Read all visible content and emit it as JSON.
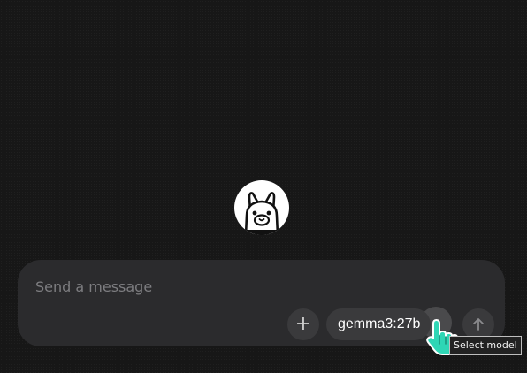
{
  "composer": {
    "placeholder": "Send a message",
    "add_label": "+",
    "model_label": "gemma3:27b",
    "send_icon": "arrow-up-icon"
  },
  "tooltip": {
    "text": "Select model"
  },
  "logo": {
    "icon": "llama-icon"
  },
  "colors": {
    "background": "#171717",
    "composer_bg": "#2b2b2d",
    "button_bg": "#3a3a3c",
    "cursor": "#2fd6b5"
  }
}
